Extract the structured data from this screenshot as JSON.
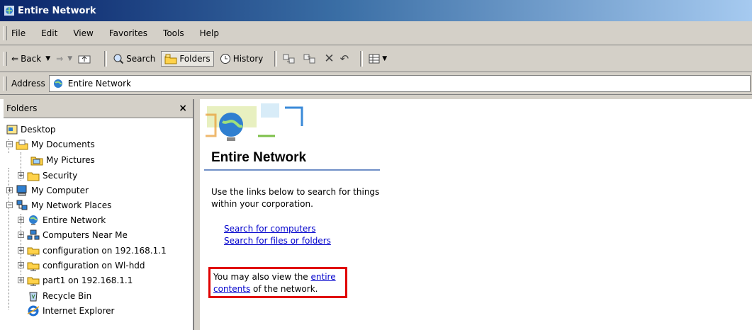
{
  "window": {
    "title": "Entire Network"
  },
  "menu": [
    "File",
    "Edit",
    "View",
    "Favorites",
    "Tools",
    "Help"
  ],
  "toolbar": {
    "back": "Back",
    "search": "Search",
    "folders": "Folders",
    "history": "History"
  },
  "address": {
    "label": "Address",
    "value": "Entire Network"
  },
  "folders_pane": {
    "title": "Folders",
    "close": "×",
    "items": [
      {
        "label": "Desktop",
        "icon": "desktop-icon"
      },
      {
        "label": "My Documents",
        "icon": "my-documents-icon"
      },
      {
        "label": "My Pictures",
        "icon": "pictures-folder-icon"
      },
      {
        "label": "Security",
        "icon": "folder-icon"
      },
      {
        "label": "My Computer",
        "icon": "computer-icon"
      },
      {
        "label": "My Network Places",
        "icon": "network-places-icon"
      },
      {
        "label": "Entire Network",
        "icon": "globe-icon"
      },
      {
        "label": "Computers Near Me",
        "icon": "workgroup-icon"
      },
      {
        "label": "configuration on 192.168.1.1",
        "icon": "network-folder-icon"
      },
      {
        "label": "configuration on Wl-hdd",
        "icon": "network-folder-icon"
      },
      {
        "label": "part1 on 192.168.1.1",
        "icon": "network-folder-icon"
      },
      {
        "label": "Recycle Bin",
        "icon": "recycle-bin-icon"
      },
      {
        "label": "Internet Explorer",
        "icon": "internet-explorer-icon"
      }
    ]
  },
  "content": {
    "title": "Entire Network",
    "description": "Use the links below to search for things within your corporation.",
    "link_computers": "Search for computers",
    "link_files": "Search for files or folders",
    "also_prefix": "You may also view the ",
    "also_link": "entire contents",
    "also_suffix": " of the network."
  }
}
